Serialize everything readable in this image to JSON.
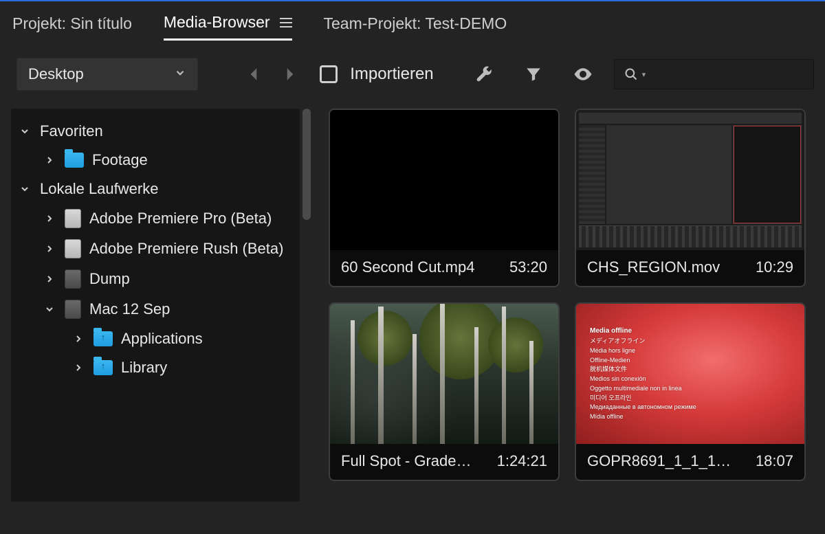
{
  "tabs": {
    "project": "Projekt: Sin título",
    "media_browser": "Media-Browser",
    "team_project": "Team-Projekt: Test-DEMO"
  },
  "toolbar": {
    "location_dropdown": "Desktop",
    "import_label": "Importieren"
  },
  "search": {
    "value": "",
    "placeholder": ""
  },
  "sidebar": {
    "favorites_label": "Favoriten",
    "favorites": [
      {
        "label": "Footage"
      }
    ],
    "local_drives_label": "Lokale Laufwerke",
    "drives": [
      {
        "label": "Adobe Premiere Pro (Beta)"
      },
      {
        "label": "Adobe Premiere Rush (Beta)"
      },
      {
        "label": "Dump"
      },
      {
        "label": "Mac 12 Sep",
        "expanded": true,
        "children": [
          {
            "label": "Applications"
          },
          {
            "label": "Library"
          }
        ]
      }
    ]
  },
  "media": [
    {
      "name": "60 Second Cut.mp4",
      "duration": "53:20",
      "thumb": "black"
    },
    {
      "name": "CHS_REGION.mov",
      "duration": "10:29",
      "thumb": "editor"
    },
    {
      "name": "Full Spot - Grade…",
      "duration": "1:24:21",
      "thumb": "forest"
    },
    {
      "name": "GOPR8691_1_1_1…",
      "duration": "18:07",
      "thumb": "offline"
    }
  ],
  "offline_strings": [
    "Media offline",
    "メディアオフライン",
    "Média hors ligne",
    "Offline-Medien",
    "脱机媒体文件",
    "Medios sin conexión",
    "Oggetto multimediale non in linea",
    "미디어 오프라인",
    "Медиаданные в автономном режиме",
    "Mídia offline"
  ]
}
